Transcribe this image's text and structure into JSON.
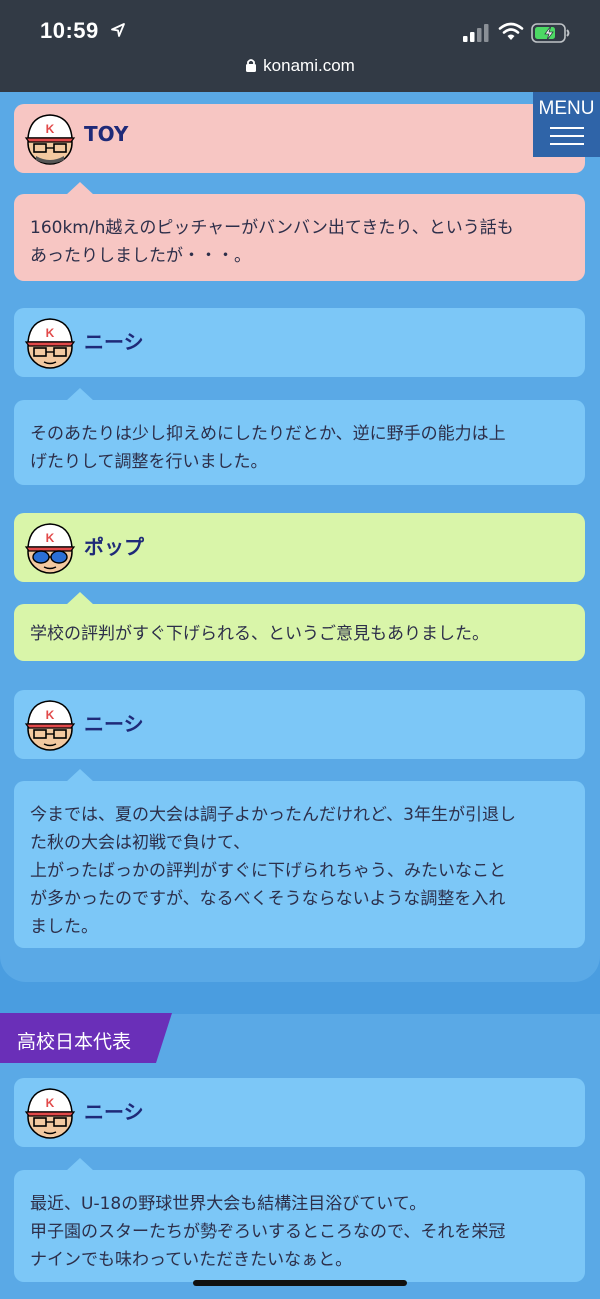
{
  "status": {
    "time": "10:59",
    "url": "konami.com"
  },
  "menu": {
    "label": "MENU"
  },
  "dialogue_1": [
    {
      "speaker": "TOY",
      "lines": [
        "160km/h越えのピッチャーがバンバン出てきたり、という話も",
        "あったりしましたが・・・。"
      ]
    },
    {
      "speaker": "ニーシ",
      "lines": [
        "そのあたりは少し抑えめにしたりだとか、逆に野手の能力は上",
        "げたりして調整を行いました。"
      ]
    },
    {
      "speaker": "ポップ",
      "lines": [
        "学校の評判がすぐ下げられる、というご意見もありました。"
      ]
    },
    {
      "speaker": "ニーシ",
      "lines": [
        "今までは、夏の大会は調子よかったんだけれど、3年生が引退し",
        "た秋の大会は初戦で負けて、",
        "上がったばっかの評判がすぐに下げられちゃう、みたいなこと",
        "が多かったのですが、なるべくそうならないような調整を入れ",
        "ました。"
      ]
    }
  ],
  "section": {
    "title": "高校日本代表"
  },
  "dialogue_2": [
    {
      "speaker": "ニーシ",
      "lines": [
        "最近、U-18の野球世界大会も結構注目浴びていて。",
        "甲子園のスターたちが勢ぞろいするところなので、それを栄冠",
        "ナインでも味わっていただきたいなぁと。"
      ]
    }
  ],
  "colors": {
    "pink": "#f7c6c3",
    "blue": "#7cc7f7",
    "green": "#d9f5a9",
    "section_tab": "#6a2fb8"
  }
}
